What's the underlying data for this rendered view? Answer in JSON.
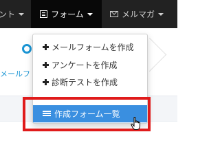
{
  "navbar": {
    "items": [
      {
        "label": "ント"
      },
      {
        "label": "フォーム"
      },
      {
        "label": "メルマガ"
      }
    ]
  },
  "background": {
    "label": "メールフ"
  },
  "dropdown": {
    "items": [
      {
        "label": "メールフォームを作成",
        "icon": "plus-icon"
      },
      {
        "label": "アンケートを作成",
        "icon": "plus-icon"
      },
      {
        "label": "診断テストを作成",
        "icon": "plus-icon"
      }
    ],
    "active_item": {
      "label": "作成フォーム一覧",
      "icon": "list-icon"
    }
  },
  "colors": {
    "navbar_bg": "#222222",
    "active_nav_bg": "#080808",
    "accent_blue": "#3a8fe0",
    "highlight_red": "#e01b1b",
    "link_blue": "#1a95d4"
  }
}
